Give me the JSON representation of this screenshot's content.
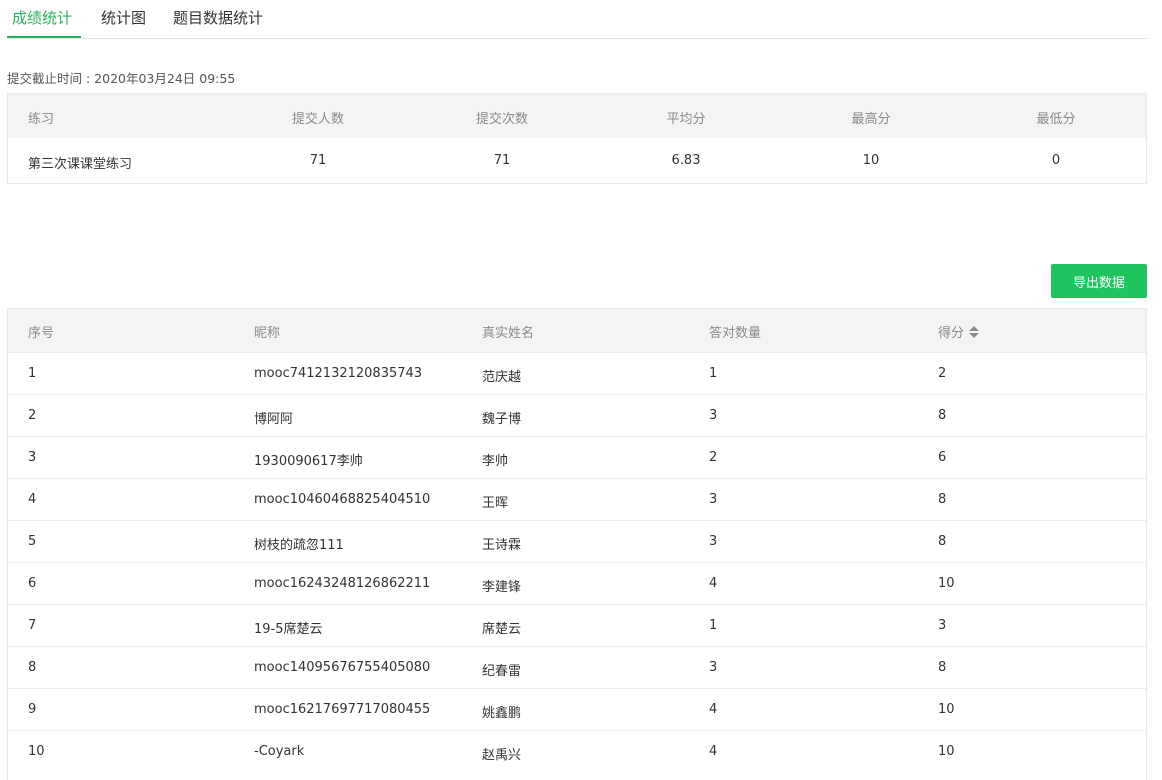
{
  "tabs": [
    {
      "label": "成绩统计",
      "active": true
    },
    {
      "label": "统计图",
      "active": false
    },
    {
      "label": "题目数据统计",
      "active": false
    }
  ],
  "deadline": "提交截止时间 : 2020年03月24日 09:55",
  "summary": {
    "headers": [
      "练习",
      "提交人数",
      "提交次数",
      "平均分",
      "最高分",
      "最低分"
    ],
    "row": [
      "第三次课课堂练习",
      "71",
      "71",
      "6.83",
      "10",
      "0"
    ]
  },
  "export_label": "导出数据",
  "table": {
    "headers": [
      "序号",
      "昵称",
      "真实姓名",
      "答对数量",
      "得分"
    ],
    "sort_icon": "sort-caret-icon",
    "rows": [
      [
        "1",
        "mooc7412132120835743",
        "范庆越",
        "1",
        "2"
      ],
      [
        "2",
        "博阿阿",
        "魏子博",
        "3",
        "8"
      ],
      [
        "3",
        "1930090617李帅",
        "李帅",
        "2",
        "6"
      ],
      [
        "4",
        "mooc10460468825404510",
        "王晖",
        "3",
        "8"
      ],
      [
        "5",
        "树枝的疏忽111",
        "王诗霖",
        "3",
        "8"
      ],
      [
        "6",
        "mooc16243248126862211",
        "李建锋",
        "4",
        "10"
      ],
      [
        "7",
        "19-5席楚云",
        "席楚云",
        "1",
        "3"
      ],
      [
        "8",
        "mooc14095676755405080",
        "纪春雷",
        "3",
        "8"
      ],
      [
        "9",
        "mooc16217697717080455",
        "姚鑫鹏",
        "4",
        "10"
      ],
      [
        "10",
        "-Coyark",
        "赵禹兴",
        "4",
        "10"
      ]
    ]
  },
  "colors": {
    "accent": "#2bb05b",
    "button": "#1fc45f",
    "header_bg": "#f3f5f5"
  }
}
